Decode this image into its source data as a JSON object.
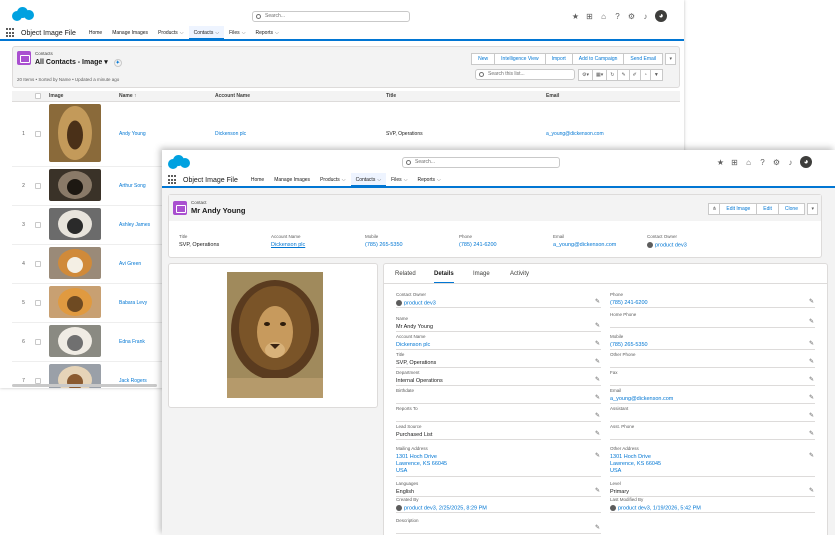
{
  "search_placeholder": "Search...",
  "search_placeholder_front": "Search...",
  "app_name": "Object Image File",
  "nav": [
    {
      "label": "Home",
      "chev": false
    },
    {
      "label": "Manage Images",
      "chev": false
    },
    {
      "label": "Products",
      "chev": true
    },
    {
      "label": "Contacts",
      "chev": true,
      "active": true
    },
    {
      "label": "Files",
      "chev": true
    },
    {
      "label": "Reports",
      "chev": true
    }
  ],
  "list": {
    "object_label": "Contacts",
    "view_name": "All Contacts - Image",
    "status": "20 Items • Sorted by Name • Updated a minute ago",
    "search_placeholder": "Search this list...",
    "buttons": [
      "New",
      "Intelligence View",
      "Import",
      "Add to Campaign",
      "Send Email"
    ],
    "columns": [
      "Image",
      "Name ↑",
      "Account Name",
      "Title",
      "Email"
    ],
    "rows": [
      {
        "num": "1",
        "name": "Andy Young",
        "account": "Dickenson plc",
        "title": "SVP, Operations",
        "email": "a_young@dickenson.com",
        "img": "lion"
      },
      {
        "num": "2",
        "name": "Arthur Song",
        "account": "",
        "title": "",
        "email": "",
        "img": "cat-dark"
      },
      {
        "num": "3",
        "name": "Ashley James",
        "account": "",
        "title": "",
        "email": "",
        "img": "dog-bw"
      },
      {
        "num": "4",
        "name": "Avi Green",
        "account": "",
        "title": "",
        "email": "",
        "img": "collie"
      },
      {
        "num": "5",
        "name": "Babara Levy",
        "account": "",
        "title": "",
        "email": "",
        "img": "cat-orange"
      },
      {
        "num": "6",
        "name": "Edna Frank",
        "account": "",
        "title": "",
        "email": "",
        "img": "kitten"
      },
      {
        "num": "7",
        "name": "Jack Rogers",
        "account": "",
        "title": "",
        "email": "",
        "img": "dog-small"
      }
    ]
  },
  "record": {
    "object_label": "Contact",
    "name": "Mr Andy Young",
    "buttons": [
      "Edit Image",
      "Edit",
      "Clone"
    ],
    "highlights": [
      {
        "label": "Title",
        "value": "SVP, Operations",
        "link": false
      },
      {
        "label": "Account Name",
        "value": "Dickenson plc",
        "link": true
      },
      {
        "label": "Mobile",
        "value": "(785) 265-5350",
        "link": true
      },
      {
        "label": "Phone",
        "value": "(785) 241-6200",
        "link": true
      },
      {
        "label": "Email",
        "value": "a_young@dickenson.com",
        "link": true
      },
      {
        "label": "Contact Owner",
        "value": "product dev3",
        "link": true
      }
    ],
    "tabs": [
      "Related",
      "Details",
      "Image",
      "Activity"
    ],
    "left_fields": [
      {
        "label": "Contact Owner",
        "value": "product dev3",
        "link": true
      },
      {
        "label": "Name",
        "value": "Mr Andy Young",
        "link": false
      },
      {
        "label": "Account Name",
        "value": "Dickenson plc",
        "link": true
      },
      {
        "label": "Title",
        "value": "SVP, Operations",
        "link": false
      },
      {
        "label": "Department",
        "value": "Internal Operations",
        "link": false
      },
      {
        "label": "Birthdate",
        "value": "",
        "link": false
      },
      {
        "label": "Reports To",
        "value": "",
        "link": false
      },
      {
        "label": "Lead Source",
        "value": "Purchased List",
        "link": false
      },
      {
        "label": "Mailing Address",
        "value": "1301 Hoch Drive\nLawrence, KS 66045\nUSA",
        "link": true
      },
      {
        "label": "Languages",
        "value": "English",
        "link": false
      },
      {
        "label": "Created By",
        "value": "product dev3, 2/25/2025, 8:29 PM",
        "link": true
      },
      {
        "label": "Description",
        "value": "",
        "link": false
      }
    ],
    "right_fields": [
      {
        "label": "Phone",
        "value": "(785) 241-6200",
        "link": true
      },
      {
        "label": "Home Phone",
        "value": "",
        "link": false
      },
      {
        "label": "Mobile",
        "value": "(785) 265-5350",
        "link": true
      },
      {
        "label": "Other Phone",
        "value": "",
        "link": false
      },
      {
        "label": "Fax",
        "value": "",
        "link": false
      },
      {
        "label": "Email",
        "value": "a_young@dickenson.com",
        "link": true
      },
      {
        "label": "Assistant",
        "value": "",
        "link": false
      },
      {
        "label": "Asst. Phone",
        "value": "",
        "link": false
      },
      {
        "label": "Other Address",
        "value": "1301 Hoch Drive\nLawrence, KS 66045\nUSA",
        "link": true
      },
      {
        "label": "Level",
        "value": "Primary",
        "link": false
      },
      {
        "label": "Last Modified By",
        "value": "product dev3, 1/19/2026, 5:42 PM",
        "link": true
      }
    ]
  },
  "colors": {
    "brand": "#00a1e0",
    "accent": "#0176d3",
    "object_icon": "#a94fd0"
  }
}
